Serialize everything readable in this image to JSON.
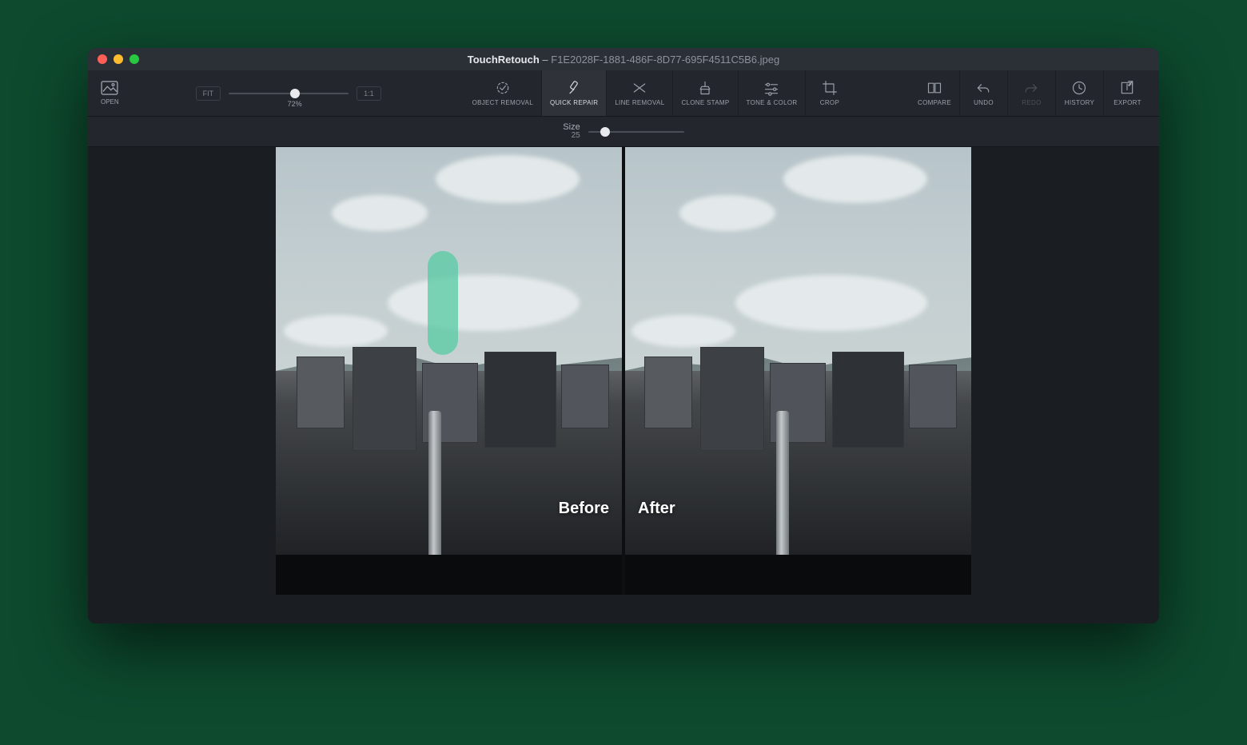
{
  "title": {
    "app": "TouchRetouch",
    "sep": " – ",
    "file": "F1E2028F-1881-486F-8D77-695F4511C5B6.jpeg"
  },
  "open": {
    "label": "OPEN"
  },
  "zoom": {
    "fit_label": "FIT",
    "oneone_label": "1:1",
    "value_pct": "72%",
    "value_frac": 0.55
  },
  "tools": [
    {
      "key": "object-removal",
      "label": "OBJECT REMOVAL",
      "active": false
    },
    {
      "key": "quick-repair",
      "label": "QUICK REPAIR",
      "active": true
    },
    {
      "key": "line-removal",
      "label": "LINE REMOVAL",
      "active": false
    },
    {
      "key": "clone-stamp",
      "label": "CLONE STAMP",
      "active": false
    },
    {
      "key": "tone-color",
      "label": "TONE & COLOR",
      "active": false
    },
    {
      "key": "crop",
      "label": "CROP",
      "active": false
    }
  ],
  "right": [
    {
      "key": "compare",
      "label": "COMPARE",
      "disabled": false
    },
    {
      "key": "undo",
      "label": "UNDO",
      "disabled": false
    },
    {
      "key": "redo",
      "label": "REDO",
      "disabled": true
    },
    {
      "key": "history",
      "label": "HISTORY",
      "disabled": false
    },
    {
      "key": "export",
      "label": "EXPORT",
      "disabled": false
    }
  ],
  "size": {
    "label": "Size",
    "value": "25",
    "frac": 0.18
  },
  "compare_labels": {
    "before": "Before",
    "after": "After"
  },
  "brush_color": "#56c9a1"
}
